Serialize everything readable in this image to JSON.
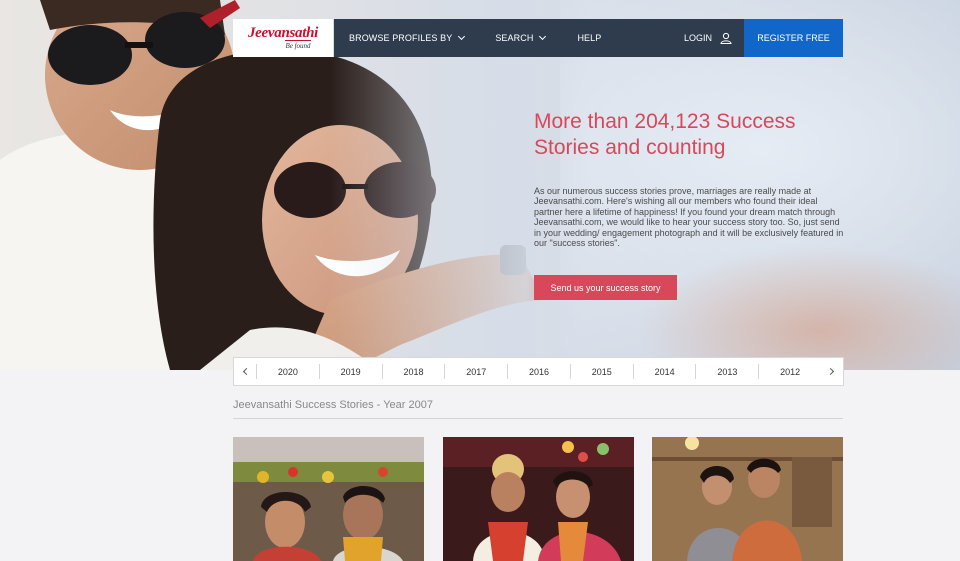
{
  "nav": {
    "logo_text": "Jeevansathi",
    "logo_tagline": "Be found",
    "browse_label": "BROWSE PROFILES BY",
    "search_label": "SEARCH",
    "help_label": "HELP",
    "login_label": "LOGIN",
    "register_label": "REGISTER FREE"
  },
  "hero": {
    "headline": "More than 204,123 Success Stories and counting",
    "body": "As our numerous success stories prove, marriages are really made at Jeevansathi.com. Here's wishing all our members who found their ideal partner here a lifetime of happiness! If you found your dream match through Jeevansathi.com, we would like to hear your success story too. So, just send in your wedding/ engagement photograph and it will be exclusively featured in our \"success stories\".",
    "cta_label": "Send us your success story"
  },
  "years": [
    "2020",
    "2019",
    "2018",
    "2017",
    "2016",
    "2015",
    "2014",
    "2013",
    "2012"
  ],
  "section": {
    "title": "Jeevansathi Success Stories - Year 2007"
  },
  "colors": {
    "accent": "#d9475a",
    "nav_bg": "#2f3c4e",
    "register_bg": "#1167c9",
    "brand_red": "#c8102e"
  },
  "icons": {
    "user": "user-icon",
    "dropdown": "chevron-down-icon",
    "prev": "chevron-left-icon",
    "next": "chevron-right-icon"
  }
}
